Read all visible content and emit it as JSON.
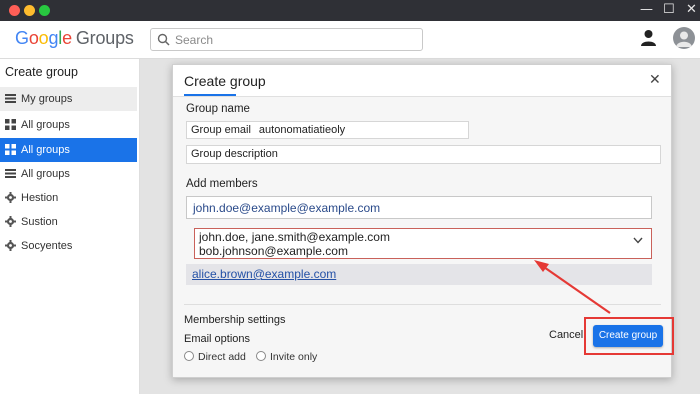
{
  "window": {
    "controls": [
      "—",
      "☐",
      "✕"
    ]
  },
  "app": {
    "logo_letters": [
      "G",
      "o",
      "o",
      "g",
      "l",
      "e"
    ],
    "product": "Groups"
  },
  "search": {
    "placeholder": "Search"
  },
  "sidebar": {
    "title": "Create group",
    "items": [
      {
        "label": "My groups",
        "icon": "list-icon"
      },
      {
        "label": "All groups",
        "icon": "grid-icon"
      },
      {
        "label": "All groups",
        "icon": "grid-icon",
        "active": true
      },
      {
        "label": "All groups",
        "icon": "list-icon"
      },
      {
        "label": "Hestion",
        "icon": "gear-icon"
      },
      {
        "label": "Sustion",
        "icon": "gear-icon"
      },
      {
        "label": "Socyentes",
        "icon": "gear-icon"
      }
    ]
  },
  "dialog": {
    "title": "Create group",
    "group_name_label": "Group name",
    "group_email_key": "Group email",
    "group_email_value": "autonomatiatieoly",
    "group_description_placeholder": "Group description",
    "add_members_label": "Add members",
    "member_input_value": "john.doe@example@example.com",
    "dropdown_line1": "john.doe, jane.smith@example.com",
    "dropdown_line2": "bob.johnson@example.com",
    "suggestion": "alice.brown@example.com",
    "membership_settings_label": "Membership settings",
    "email_options_label": "Email options",
    "radio_direct": "Direct add",
    "radio_invite": "Invite only",
    "cancel_label": "Cancel",
    "create_label": "Create group"
  },
  "colors": {
    "accent": "#1a73e8",
    "highlight": "#e53935",
    "titlebar": "#2f3036"
  }
}
